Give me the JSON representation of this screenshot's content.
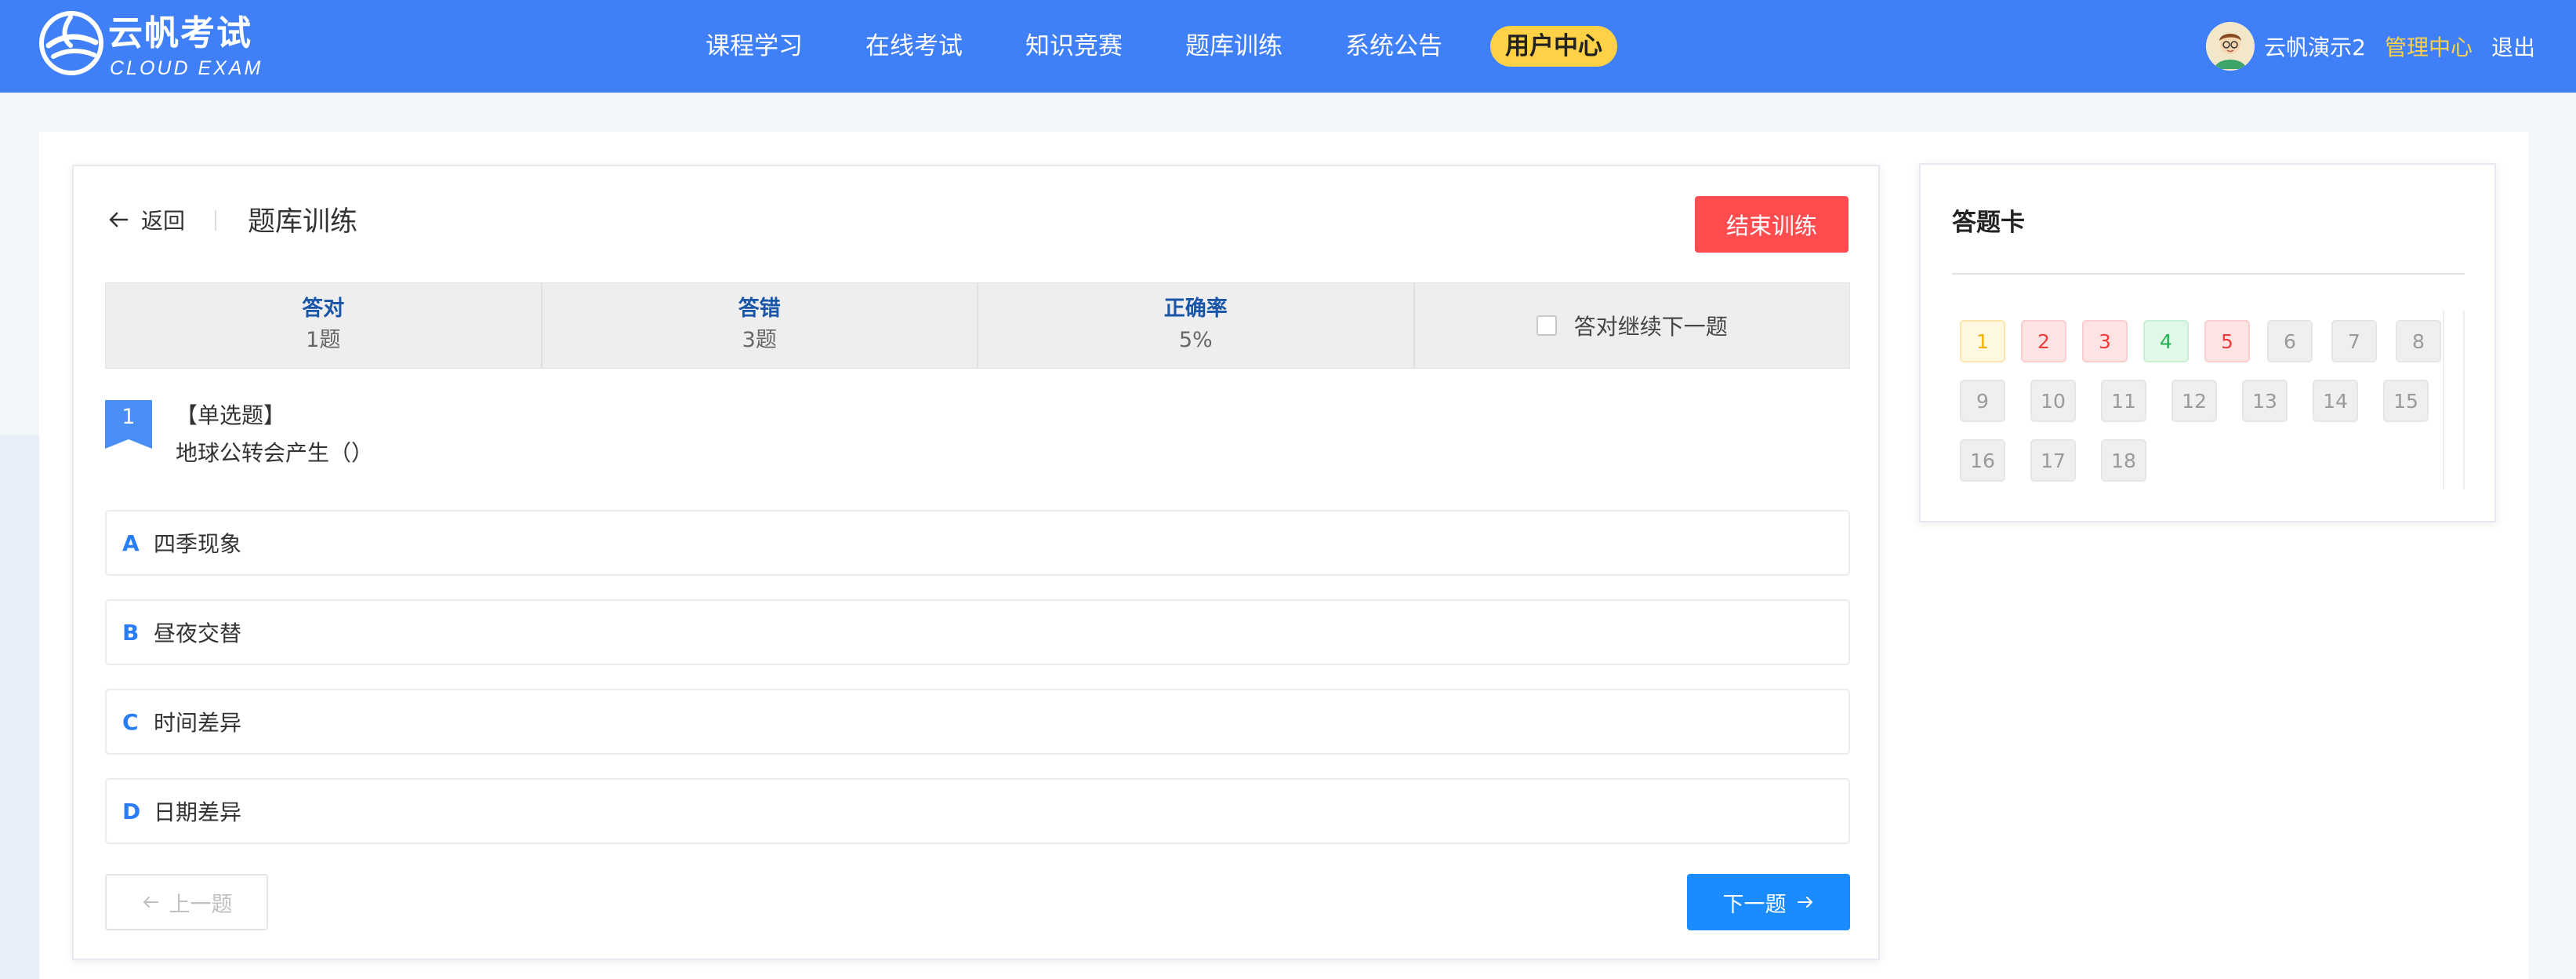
{
  "header": {
    "logo_cn": "云帆考试",
    "logo_en": "CLOUD EXAM",
    "nav": [
      "课程学习",
      "在线考试",
      "知识竞赛",
      "题库训练",
      "系统公告",
      "用户中心"
    ],
    "active_nav": "用户中心",
    "user_name": "云帆演示2",
    "admin_label": "管理中心",
    "logout_label": "退出"
  },
  "main": {
    "back_label": "返回",
    "title": "题库训练",
    "end_button": "结束训练",
    "stats": {
      "correct_label": "答对",
      "correct_value": "1题",
      "wrong_label": "答错",
      "wrong_value": "3题",
      "rate_label": "正确率",
      "rate_value": "5%",
      "continue_label": "答对继续下一题"
    },
    "question": {
      "number": "1",
      "type": "【单选题】",
      "text": "地球公转会产生（）",
      "options": [
        {
          "letter": "A",
          "text": "四季现象"
        },
        {
          "letter": "B",
          "text": "昼夜交替"
        },
        {
          "letter": "C",
          "text": "时间差异"
        },
        {
          "letter": "D",
          "text": "日期差异"
        }
      ]
    },
    "prev_label": "上一题",
    "next_label": "下一题"
  },
  "answer_card": {
    "title": "答题卡",
    "cells": [
      {
        "label": "1",
        "state": "current"
      },
      {
        "label": "2",
        "state": "wrong"
      },
      {
        "label": "3",
        "state": "wrong"
      },
      {
        "label": "4",
        "state": "right"
      },
      {
        "label": "5",
        "state": "wrong"
      },
      {
        "label": "6",
        "state": "unanswered"
      },
      {
        "label": "7",
        "state": "unanswered"
      },
      {
        "label": "8",
        "state": "unanswered"
      },
      {
        "label": "9",
        "state": "unanswered"
      },
      {
        "label": "10",
        "state": "unanswered"
      },
      {
        "label": "11",
        "state": "unanswered"
      },
      {
        "label": "12",
        "state": "unanswered"
      },
      {
        "label": "13",
        "state": "unanswered"
      },
      {
        "label": "14",
        "state": "unanswered"
      },
      {
        "label": "15",
        "state": "unanswered"
      },
      {
        "label": "16",
        "state": "unanswered"
      },
      {
        "label": "17",
        "state": "unanswered"
      },
      {
        "label": "18",
        "state": "unanswered"
      }
    ]
  },
  "colors": {
    "header_bg": "#3f7ff8",
    "accent_yellow": "#ffd146",
    "danger": "#ff4d4f",
    "primary": "#1a8cff",
    "stat_blue": "#1a56a8"
  }
}
